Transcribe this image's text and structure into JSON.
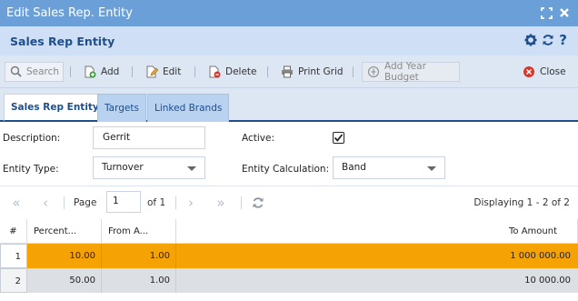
{
  "window": {
    "title": "Edit Sales Rep. Entity"
  },
  "header": {
    "title": "Sales Rep Entity"
  },
  "toolbar": {
    "search_label": "Search",
    "add_label": "Add",
    "edit_label": "Edit",
    "delete_label": "Delete",
    "print_label": "Print Grid",
    "add_year_budget_label": "Add Year Budget",
    "close_label": "Close"
  },
  "tabs": [
    "Sales Rep Entity",
    "Targets",
    "Linked Brands"
  ],
  "form": {
    "description_label": "Description:",
    "description_value": "Gerrit",
    "active_label": "Active:",
    "active_checked": true,
    "entity_type_label": "Entity Type:",
    "entity_type_value": "Turnover",
    "entity_calc_label": "Entity Calculation:",
    "entity_calc_value": "Band"
  },
  "pager": {
    "page_label": "Page",
    "page_value": "1",
    "of_label": "of 1",
    "display_text": "Displaying 1 - 2 of 2"
  },
  "grid": {
    "columns": [
      "#",
      "Percent...",
      "From A...",
      "To Amount"
    ],
    "rows": [
      {
        "num": "1",
        "percent": "10.00",
        "from": "1.00",
        "to": "1 000 000.00"
      },
      {
        "num": "2",
        "percent": "50.00",
        "from": "1.00",
        "to": "10 000.00"
      }
    ]
  },
  "colors": {
    "titlebar": "#6a9fd8",
    "header": "#cfe0f6",
    "accent": "#1f4e8c",
    "selected_row": "#f5a204"
  }
}
